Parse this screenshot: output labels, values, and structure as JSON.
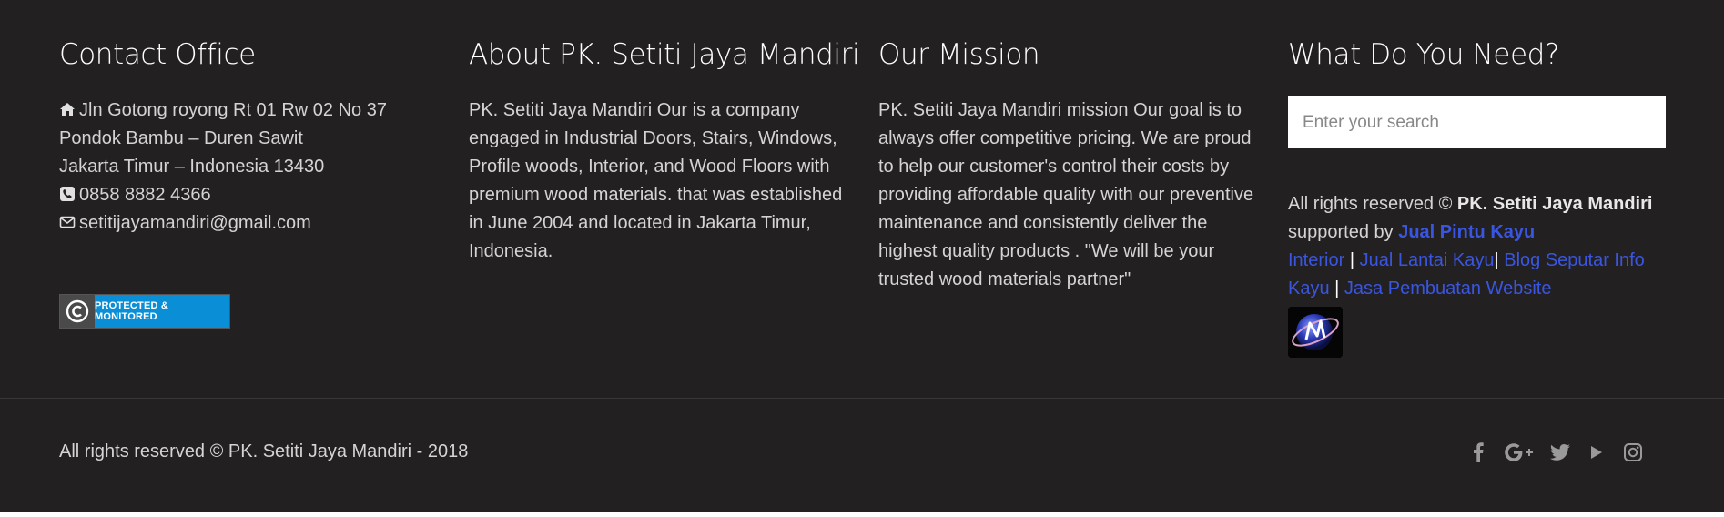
{
  "contact": {
    "heading": "Contact Office",
    "address_line1": "Jln Gotong royong Rt 01 Rw 02 No 37",
    "address_line2": "Pondok Bambu – Duren Sawit",
    "address_line3": "Jakarta Timur – Indonesia 13430",
    "phone": "0858 8882 4366",
    "email": "setitijayamandiri@gmail.com",
    "badge_text": "PROTECTED & MONITORED"
  },
  "about": {
    "heading": "About PK. Setiti Jaya Mandiri",
    "lines": [
      "PK. Setiti Jaya Mandiri Our is a company",
      "engaged in Industrial Doors, Stairs, Windows,",
      "Profile woods, Interior, and Wood Floors with",
      "premium wood materials. that was established",
      "in June 2004 and located in Jakarta Timur,",
      "Indonesia."
    ]
  },
  "mission": {
    "heading": "Our Mission",
    "lines": [
      "PK. Setiti Jaya Mandiri mission Our goal is to",
      "always offer competitive pricing. We are proud",
      "to help our customer's control their costs by",
      "providing affordable quality with our preventive",
      "maintenance and consistently deliver the",
      "highest quality products . \"We will be your",
      "trusted wood materials partner\""
    ]
  },
  "need": {
    "heading": "What Do You Need?",
    "search_placeholder": "Enter your search",
    "rights_prefix": "All rights reserved ©",
    "rights_company": "PK. Setiti Jaya Mandiri",
    "supported_by": "supported by",
    "link1a": "Jual Pintu Kayu",
    "link1b": "Interior",
    "sep1": "|",
    "link2": "Jual Lantai Kayu",
    "sep2": "|",
    "link3a": "Blog Seputar Info",
    "link3b": "Kayu",
    "sep3": "|",
    "link4": "Jasa Pembuatan Website"
  },
  "footer": {
    "copyright": "All rights reserved © PK. Setiti Jaya Mandiri - 2018"
  },
  "social": [
    "facebook-icon",
    "google-plus-icon",
    "twitter-icon",
    "youtube-icon",
    "instagram-icon"
  ],
  "colors": {
    "background": "#232021",
    "link": "#3a56e0",
    "badge_blue": "#0a8fd6"
  }
}
